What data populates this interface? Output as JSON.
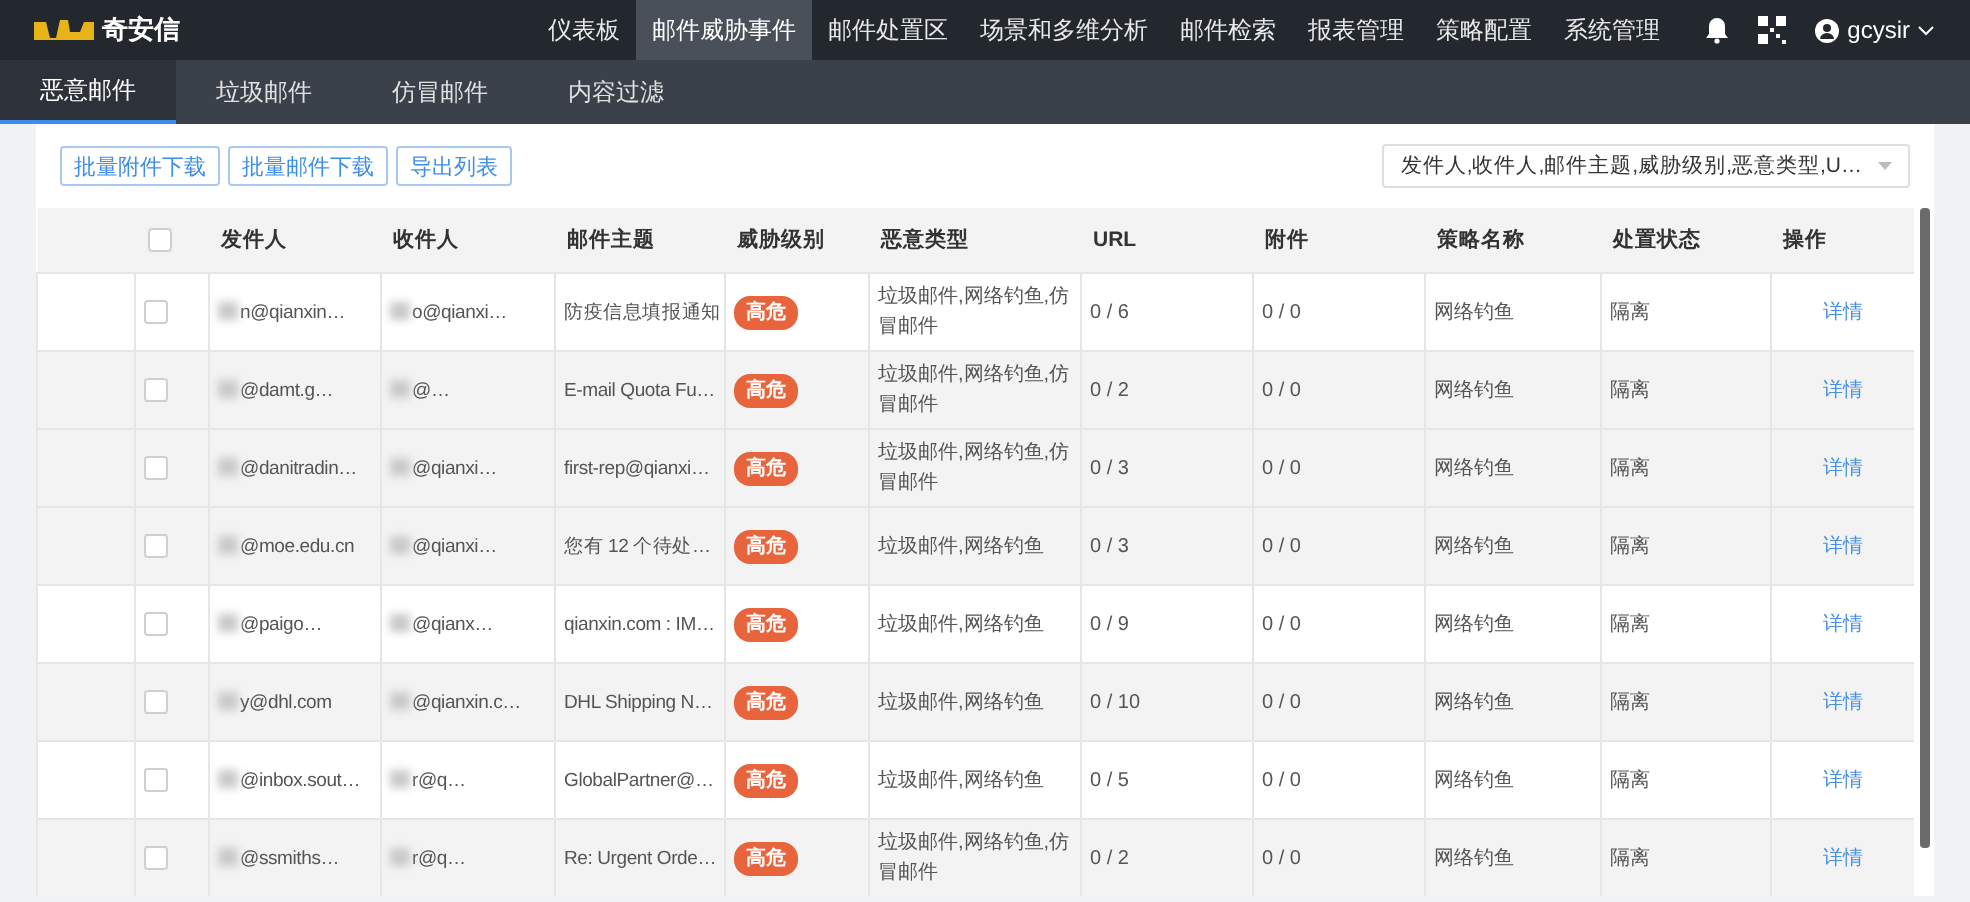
{
  "brand": {
    "name": "奇安信"
  },
  "nav": {
    "items": [
      {
        "label": "仪表板",
        "selected": false
      },
      {
        "label": "邮件威胁事件",
        "selected": true
      },
      {
        "label": "邮件处置区",
        "selected": false
      },
      {
        "label": "场景和多维分析",
        "selected": false
      },
      {
        "label": "邮件检索",
        "selected": false
      },
      {
        "label": "报表管理",
        "selected": false
      },
      {
        "label": "策略配置",
        "selected": false
      },
      {
        "label": "系统管理",
        "selected": false
      }
    ],
    "user": "gcysir"
  },
  "tabs": [
    {
      "label": "恶意邮件",
      "selected": true
    },
    {
      "label": "垃圾邮件",
      "selected": false
    },
    {
      "label": "仿冒邮件",
      "selected": false
    },
    {
      "label": "内容过滤",
      "selected": false
    }
  ],
  "toolbar": {
    "buttons": [
      "批量附件下载",
      "批量邮件下载",
      "导出列表"
    ],
    "column_select": "发件人,收件人,邮件主题,威胁级别,恶意类型,U…"
  },
  "table": {
    "columns": [
      "发件人",
      "收件人",
      "邮件主题",
      "威胁级别",
      "恶意类型",
      "URL",
      "附件",
      "策略名称",
      "处置状态",
      "操作"
    ],
    "header_checked": false,
    "rows": [
      {
        "checked": false,
        "highlighted": false,
        "sender": "n@qianxin…",
        "recipient": "o@qianxi…",
        "subject": "防疫信息填报通知",
        "threat": "高危",
        "type": "垃圾邮件,网络钓鱼,仿冒邮件",
        "url": "0 / 6",
        "attachment": "0 / 0",
        "policy": "网络钓鱼",
        "status": "隔离",
        "action": "详情"
      },
      {
        "checked": false,
        "highlighted": true,
        "sender": "@damt.g…",
        "recipient": "@…",
        "subject": "E-mail Quota Fu…",
        "threat": "高危",
        "type": "垃圾邮件,网络钓鱼,仿冒邮件",
        "url": "0 / 2",
        "attachment": "0 / 0",
        "policy": "网络钓鱼",
        "status": "隔离",
        "action": "详情"
      },
      {
        "checked": false,
        "highlighted": true,
        "sender": "@danitradin…",
        "recipient": "@qianxi…",
        "subject": "first-rep@qianxi…",
        "threat": "高危",
        "type": "垃圾邮件,网络钓鱼,仿冒邮件",
        "url": "0 / 3",
        "attachment": "0 / 0",
        "policy": "网络钓鱼",
        "status": "隔离",
        "action": "详情"
      },
      {
        "checked": false,
        "highlighted": true,
        "sender": "@moe.edu.cn",
        "recipient": "@qianxi…",
        "subject": "您有 12 个待处…",
        "threat": "高危",
        "type": "垃圾邮件,网络钓鱼",
        "url": "0 / 3",
        "attachment": "0 / 0",
        "policy": "网络钓鱼",
        "status": "隔离",
        "action": "详情"
      },
      {
        "checked": false,
        "highlighted": false,
        "sender": "@paigo…",
        "recipient": "@qianx…",
        "subject": "qianxin.com : IM…",
        "threat": "高危",
        "type": "垃圾邮件,网络钓鱼",
        "url": "0 / 9",
        "attachment": "0 / 0",
        "policy": "网络钓鱼",
        "status": "隔离",
        "action": "详情"
      },
      {
        "checked": false,
        "highlighted": true,
        "sender": "y@dhl.com",
        "recipient": "@qianxin.c…",
        "subject": "DHL Shipping N…",
        "threat": "高危",
        "type": "垃圾邮件,网络钓鱼",
        "url": "0 / 10",
        "attachment": "0 / 0",
        "policy": "网络钓鱼",
        "status": "隔离",
        "action": "详情"
      },
      {
        "checked": false,
        "highlighted": false,
        "sender": "@inbox.sout…",
        "recipient": "r@q…",
        "subject": "GlobalPartner@…",
        "threat": "高危",
        "type": "垃圾邮件,网络钓鱼",
        "url": "0 / 5",
        "attachment": "0 / 0",
        "policy": "网络钓鱼",
        "status": "隔离",
        "action": "详情"
      },
      {
        "checked": false,
        "highlighted": true,
        "sender": "@ssmiths…",
        "recipient": "r@q…",
        "subject": "Re: Urgent Orde…",
        "threat": "高危",
        "type": "垃圾邮件,网络钓鱼,仿冒邮件",
        "url": "0 / 2",
        "attachment": "0 / 0",
        "policy": "网络钓鱼",
        "status": "隔离",
        "action": "详情"
      }
    ]
  }
}
